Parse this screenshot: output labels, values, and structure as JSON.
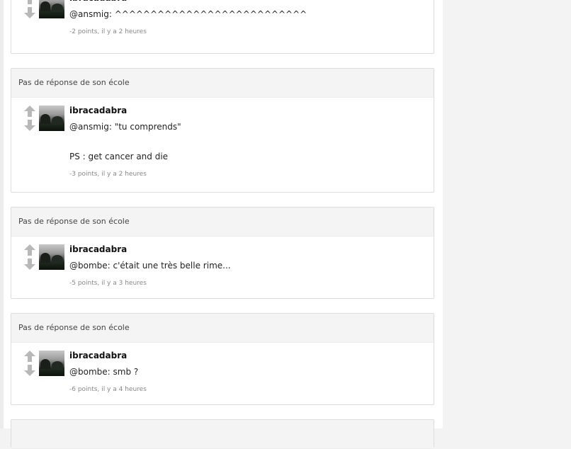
{
  "comments": [
    {
      "header": "",
      "author": "ibracadabra",
      "text": "@ansmig: ^^^^^^^^^^^^^^^^^^^^^^^^^^^",
      "meta": "-2 points, il y a 2 heures"
    },
    {
      "header": "Pas de réponse de son école",
      "author": "ibracadabra",
      "text": "@ansmig: \"tu comprends\"\n\n\nPS : get cancer and die",
      "meta": "-3 points, il y a 2 heures"
    },
    {
      "header": "Pas de réponse de son école",
      "author": "ibracadabra",
      "text": "@bombe: c'était une très belle rime...",
      "meta": "-5 points, il y a 3 heures"
    },
    {
      "header": "Pas de réponse de son école",
      "author": "ibracadabra",
      "text": "@bombe: smb ?",
      "meta": "-6 points, il y a 4 heures"
    }
  ],
  "colors": {
    "vote_arrow": "#b8b8b8",
    "header_bg": "#f4f4f4"
  },
  "icons": {
    "upvote": "up-arrow-icon",
    "downvote": "down-arrow-icon"
  }
}
